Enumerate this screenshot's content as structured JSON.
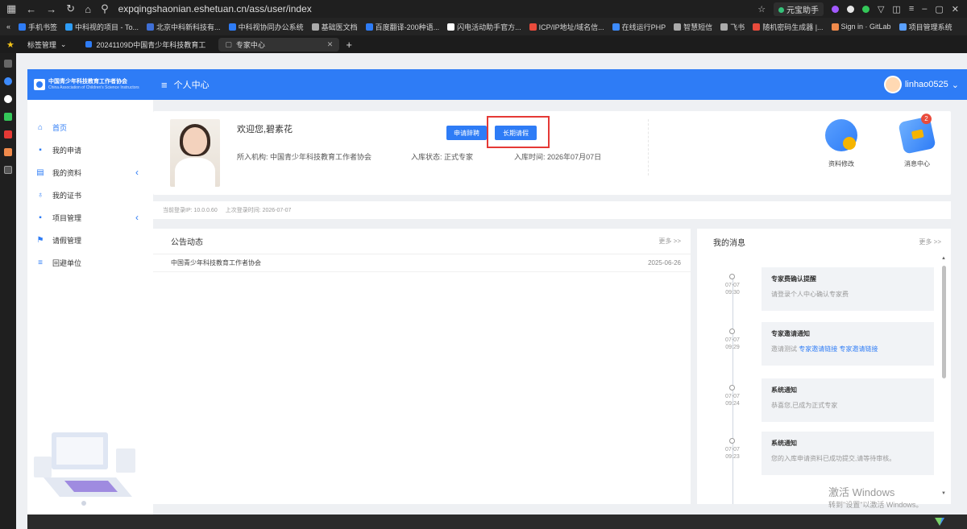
{
  "browser": {
    "url": "expqingshaonian.eshetuan.cn/ass/user/index",
    "ext_label": "元宝助手",
    "bookmarks": [
      "手机书签",
      "中科视的项目 - To...",
      "北京中科新科技有...",
      "中科视协同办公系统",
      "基础医文档",
      "百度翻译-200种语...",
      "闪电活动助手官方...",
      "ICP/IP地址/域名信...",
      "在线运行PHP",
      "智慧短信",
      "飞书",
      "随机密码生成器 |...",
      "Sign in · GitLab",
      "项目管理系统"
    ],
    "tab_group": "标签管理",
    "tab_pinned": "20241109D中国青少年科技教育工",
    "active_tab": "专家中心",
    "new_tab_label": "+"
  },
  "header": {
    "logo_title": "中国青少年科技教育工作者协会",
    "logo_sub": "China Association of Children's Science Instructors",
    "menu_toggle": "≡",
    "page_title": "个人中心",
    "username": "linhao0525",
    "user_chevron": "⌄"
  },
  "sidebar": {
    "items": [
      {
        "label": "首页",
        "icon": "home-icon"
      },
      {
        "label": "我的申请",
        "icon": "apply-icon"
      },
      {
        "label": "我的资料",
        "icon": "profile-icon",
        "chevron": "‹"
      },
      {
        "label": "我的证书",
        "icon": "certificate-icon"
      },
      {
        "label": "项目管理",
        "icon": "project-icon",
        "chevron": "‹"
      },
      {
        "label": "请假管理",
        "icon": "leave-icon"
      },
      {
        "label": "回避单位",
        "icon": "avoid-icon"
      }
    ]
  },
  "profile": {
    "welcome": "欢迎您,碧素花",
    "apply_resign_btn": "申请辞聘",
    "long_leave_btn": "长期请假",
    "org_label": "所入机构:",
    "org_value": "中国青少年科技教育工作者协会",
    "status_label": "入库状态:",
    "status_value": "正式专家",
    "time_label": "入库时间:",
    "time_value": "2026年07月07日",
    "tile_edit": "资料修改",
    "tile_msg": "消息中心",
    "msg_badge": "2"
  },
  "login_info": {
    "ip_label": "当前登录IP:",
    "ip": "10.0.0.60",
    "last_label": "上次登录时间:",
    "last_time": "2026-07-07"
  },
  "announcements": {
    "title": "公告动态",
    "more": "更多 >>",
    "rows": [
      {
        "text": "中国青少年科技教育工作者协会",
        "date": "2025-06-26"
      }
    ]
  },
  "messages": {
    "title": "我的消息",
    "more": "更多 >>",
    "items": [
      {
        "date": "07-07",
        "time": "09:30",
        "title": "专家费确认提醒",
        "body": "请登录个人中心确认专家费"
      },
      {
        "date": "07-07",
        "time": "09:29",
        "title": "专家邀请通知",
        "body_prefix": "邀请测试",
        "link1": "专家邀请链接",
        "link2": "专家邀请链接"
      },
      {
        "date": "07-07",
        "time": "09:24",
        "title": "系统通知",
        "body": "恭喜您,已成为正式专家"
      },
      {
        "date": "07-07",
        "time": "09:23",
        "title": "系统通知",
        "body": "您的入库申请资料已成功提交,请等待审核。"
      }
    ]
  },
  "watermark": {
    "line1": "激活 Windows",
    "line2": "转到\"设置\"以激活 Windows。"
  },
  "colors": {
    "primary": "#2e7cf6",
    "highlight_box": "#e53935",
    "badge": "#e94b3c"
  }
}
